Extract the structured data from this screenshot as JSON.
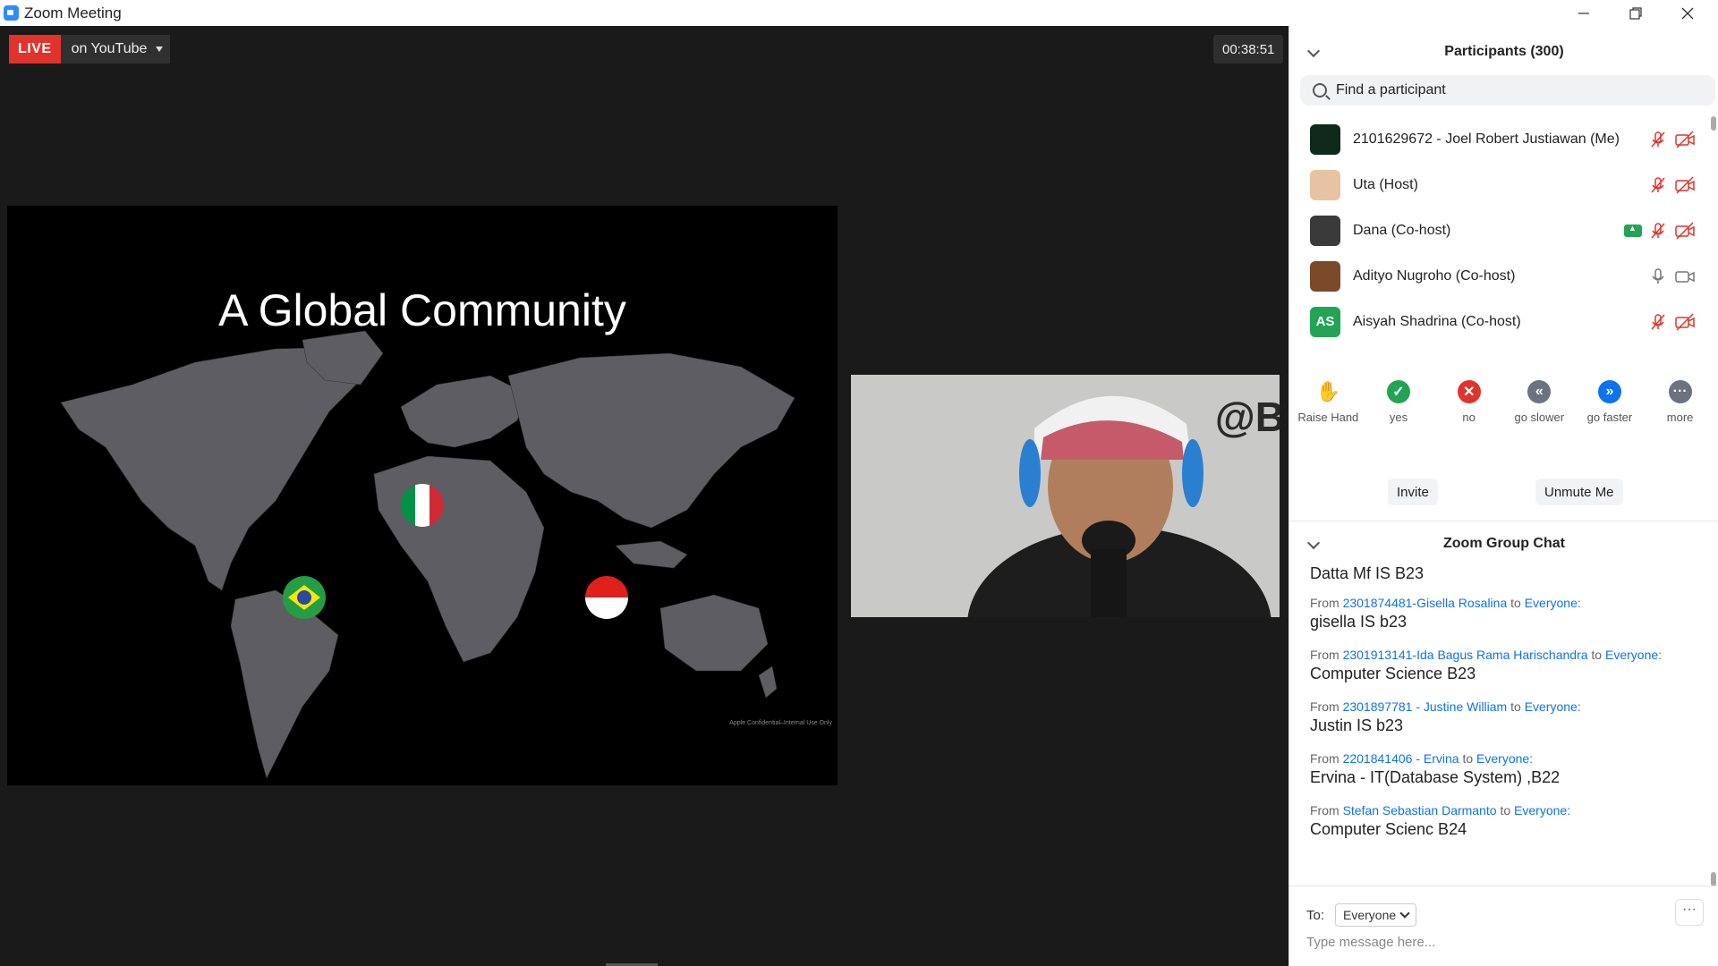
{
  "window": {
    "title": "Zoom Meeting",
    "minimize_icon": "minimize-icon",
    "restore_icon": "restore-icon",
    "close_icon": "close-icon"
  },
  "stream": {
    "live_label": "LIVE",
    "platform_label": "on YouTube"
  },
  "meeting_timer": "00:38:51",
  "slide": {
    "title": "A Global Community",
    "footer": "Apple Confidential–Internal Use Only",
    "flags": [
      "brazil-flag",
      "italy-flag",
      "indonesia-flag"
    ]
  },
  "camera": {
    "watermark": "@B"
  },
  "participants": {
    "header": "Participants (300)",
    "search_placeholder": "Find a participant",
    "list": [
      {
        "name": "2101629672 - Joel Robert Justiawan (Me)",
        "avatar_text": "",
        "avatar_color": "#0d2a1a",
        "muted": true,
        "video_off": true,
        "sharing": false
      },
      {
        "name": "Uta (Host)",
        "avatar_text": "",
        "avatar_color": "#e8c3a3",
        "muted": true,
        "video_off": true,
        "sharing": false
      },
      {
        "name": "Dana (Co-host)",
        "avatar_text": "",
        "avatar_color": "#3a3a3a",
        "muted": true,
        "video_off": true,
        "sharing": true
      },
      {
        "name": "Adityo Nugroho (Co-host)",
        "avatar_text": "",
        "avatar_color": "#7a4a2a",
        "muted": false,
        "video_off": false,
        "sharing": false
      },
      {
        "name": "Aisyah Shadrina (Co-host)",
        "avatar_text": "AS",
        "avatar_color": "#23a455",
        "muted": true,
        "video_off": true,
        "sharing": false
      }
    ],
    "reactions": [
      {
        "label": "Raise Hand",
        "icon": "raise-hand-icon",
        "color": "#2D8CFF"
      },
      {
        "label": "yes",
        "icon": "check-icon",
        "color": "#23a455"
      },
      {
        "label": "no",
        "icon": "x-icon",
        "color": "#e0332b"
      },
      {
        "label": "go slower",
        "icon": "rewind-icon",
        "color": "#6b7280"
      },
      {
        "label": "go faster",
        "icon": "fast-forward-icon",
        "color": "#0e72ed"
      },
      {
        "label": "more",
        "icon": "more-icon",
        "color": "#6b7280"
      }
    ],
    "invite_label": "Invite",
    "unmute_label": "Unmute Me"
  },
  "chat": {
    "header": "Zoom Group Chat",
    "partial_top": "Datta Mf IS B23",
    "messages": [
      {
        "from_prefix": "From",
        "sender": "2301874481-Gisella Rosalina",
        "to_word": "to",
        "recipient": "Everyone:",
        "text": "gisella IS b23"
      },
      {
        "from_prefix": "From",
        "sender": "2301913141-Ida Bagus Rama Harischandra",
        "to_word": "to",
        "recipient": "Everyone:",
        "text": "Computer Science B23"
      },
      {
        "from_prefix": "From",
        "sender": "2301897781 - Justine William",
        "to_word": "to",
        "recipient": "Everyone:",
        "text": "Justin IS b23"
      },
      {
        "from_prefix": "From",
        "sender": "2201841406 - Ervina",
        "to_word": "to",
        "recipient": "Everyone:",
        "text": "Ervina - IT(Database System) ,B22"
      },
      {
        "from_prefix": "From",
        "sender": "Stefan Sebastian Darmanto",
        "to_word": "to",
        "recipient": "Everyone:",
        "text": "Computer Scienc B24"
      }
    ],
    "to_label": "To:",
    "to_value": "Everyone",
    "more_label": "···",
    "input_placeholder": "Type message here..."
  },
  "colors": {
    "accent": "#0e72ed",
    "live_red": "#e0332b",
    "green": "#23a455"
  }
}
